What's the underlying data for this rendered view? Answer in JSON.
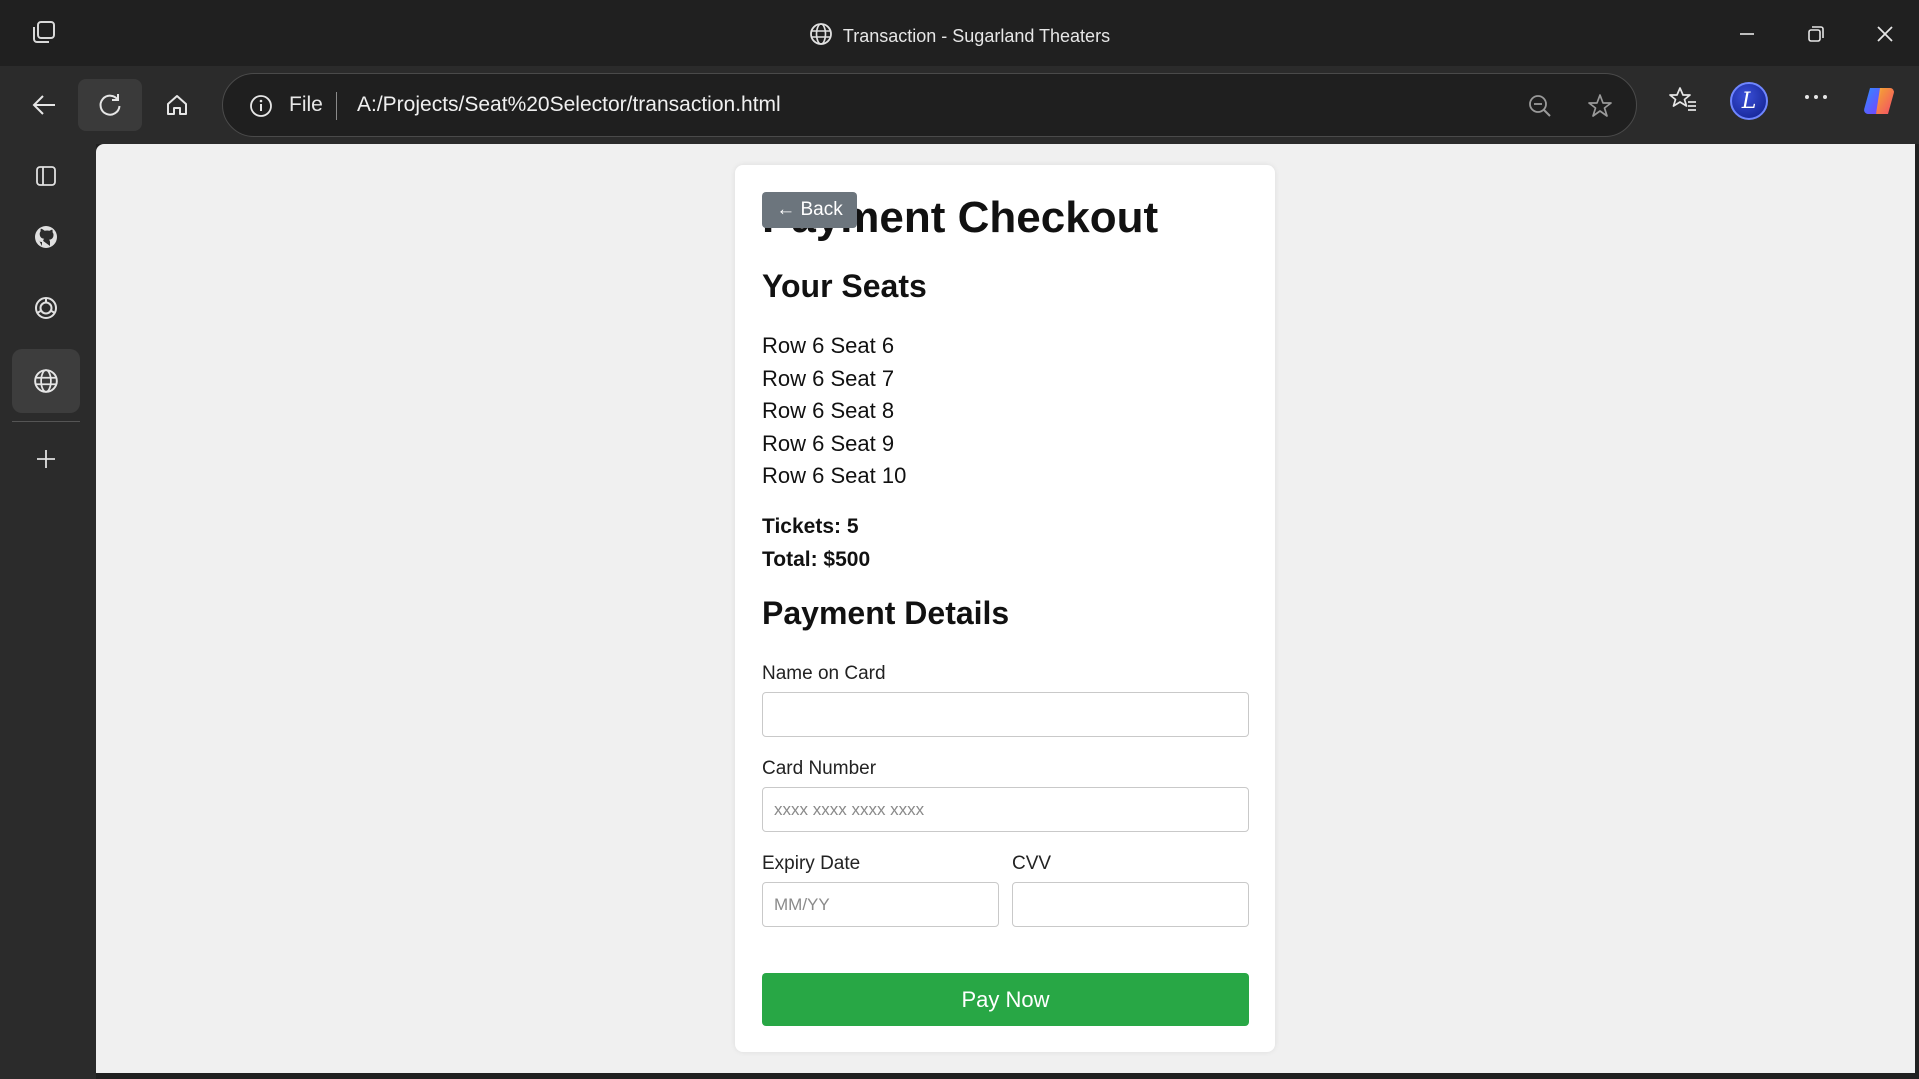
{
  "window": {
    "title": "Transaction - Sugarland Theaters"
  },
  "addressbar": {
    "scheme_label": "File",
    "url": "A:/Projects/Seat%20Selector/transaction.html"
  },
  "profile": {
    "initial": "L"
  },
  "checkout": {
    "back_label": "← Back",
    "title": "Payment Checkout",
    "seats_heading": "Your Seats",
    "seats": [
      "Row 6 Seat 6",
      "Row 6 Seat 7",
      "Row 6 Seat 8",
      "Row 6 Seat 9",
      "Row 6 Seat 10"
    ],
    "tickets_text": "Tickets: 5",
    "total_text": "Total: $500",
    "payment_heading": "Payment Details",
    "name_label": "Name on Card",
    "name_value": "",
    "card_label": "Card Number",
    "card_placeholder": "xxxx xxxx xxxx xxxx",
    "expiry_label": "Expiry Date",
    "expiry_placeholder": "MM/YY",
    "cvv_label": "CVV",
    "cvv_value": "",
    "pay_label": "Pay Now"
  },
  "colors": {
    "pay_button": "#28a745",
    "back_button": "#6c757d",
    "browser_chrome": "#202020"
  }
}
